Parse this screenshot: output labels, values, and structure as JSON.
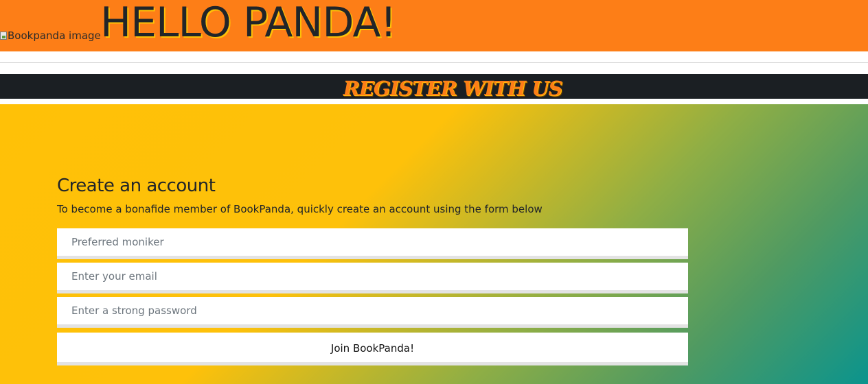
{
  "header": {
    "logo_alt": "Bookpanda image",
    "title": "HELLO PANDA!"
  },
  "banner": {
    "title": "REGISTER WITH US"
  },
  "form": {
    "heading": "Create an account",
    "subtitle": "To become a bonafide member of BookPanda, quickly create an account using the form below",
    "moniker_placeholder": "Preferred moniker",
    "email_placeholder": "Enter your email",
    "password_placeholder": "Enter a strong password",
    "submit_label": "Join BookPanda!"
  },
  "colors": {
    "topbar": "#fd7e17",
    "banner_bg": "#1b1f23",
    "banner_text": "#fd7e17",
    "gradient_start": "#ffc107",
    "gradient_end": "#0b948d"
  }
}
